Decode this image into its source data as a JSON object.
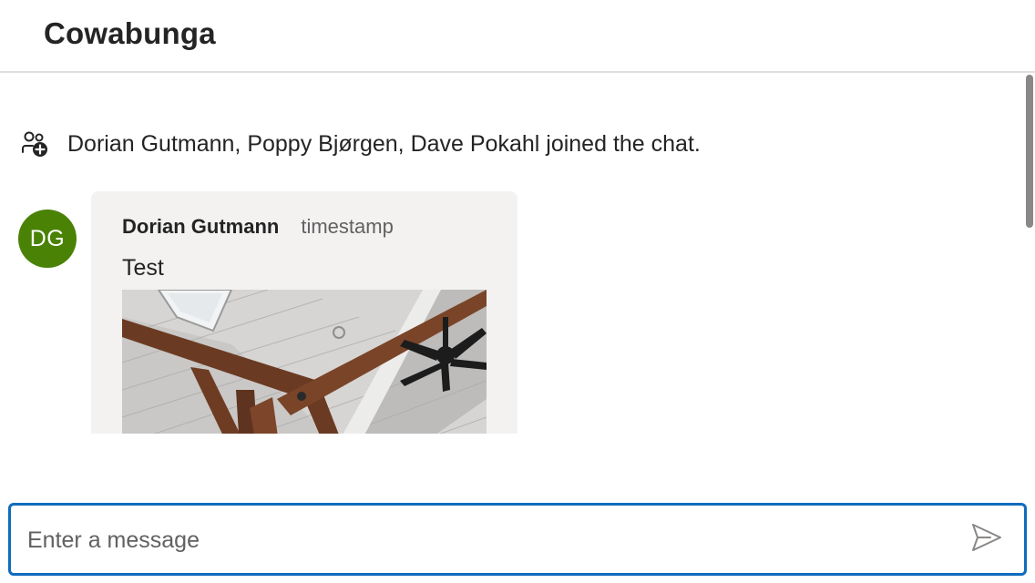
{
  "header": {
    "title": "Cowabunga"
  },
  "system_message": {
    "text": "Dorian Gutmann, Poppy Bjørgen, Dave Pokahl joined the chat.",
    "icon": "people-add-icon"
  },
  "message": {
    "avatar_initials": "DG",
    "avatar_color": "#498205",
    "author": "Dorian Gutmann",
    "timestamp": "timestamp",
    "text": "Test",
    "attachment": "image-attachment"
  },
  "composer": {
    "placeholder": "Enter a message",
    "value": "",
    "send_icon": "send-icon",
    "accent_color": "#0f6cbd"
  }
}
